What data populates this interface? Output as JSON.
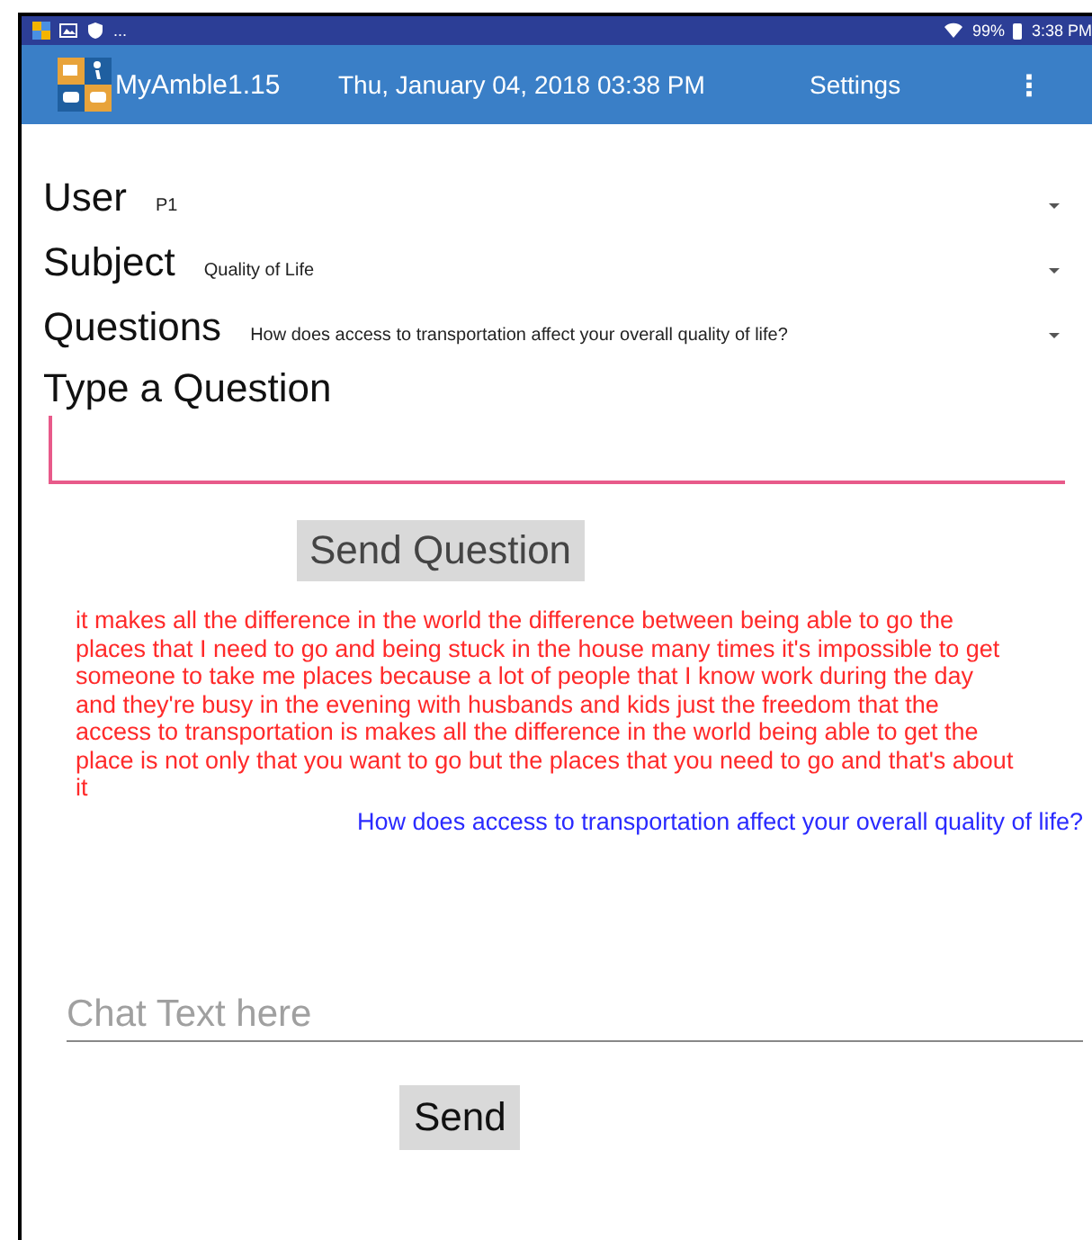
{
  "status_bar": {
    "overflow": "...",
    "battery": "99%",
    "time": "3:38 PM"
  },
  "app_bar": {
    "title": "MyAmble1.15",
    "datetime": "Thu, January 04, 2018 03:38 PM",
    "settings": "Settings",
    "menu": "⋮"
  },
  "selectors": [
    {
      "label": "User",
      "value": "P1"
    },
    {
      "label": "Subject",
      "value": "Quality of Life"
    },
    {
      "label": "Questions",
      "value": "How does access to transportation affect your overall quality of life?"
    }
  ],
  "question_heading": "Type a Question",
  "send_question_button": "Send Question",
  "messages": [
    {
      "kind": "answer",
      "text": "it makes all the difference in the world the difference between being able to go the places that I need to go and being stuck in the house many times it's impossible to get someone to take me places because a lot of people that I know work during the day and they're busy in the evening with husbands and kids just the freedom that the access to transportation is makes all the difference in the world being able to get the place is not only that you want to go but the places that you need to go and that's about it"
    },
    {
      "kind": "question",
      "text": "How does access to transportation affect your overall quality of life?"
    }
  ],
  "chat_field": {
    "placeholder": "Chat Text here"
  },
  "send_button": "Send"
}
